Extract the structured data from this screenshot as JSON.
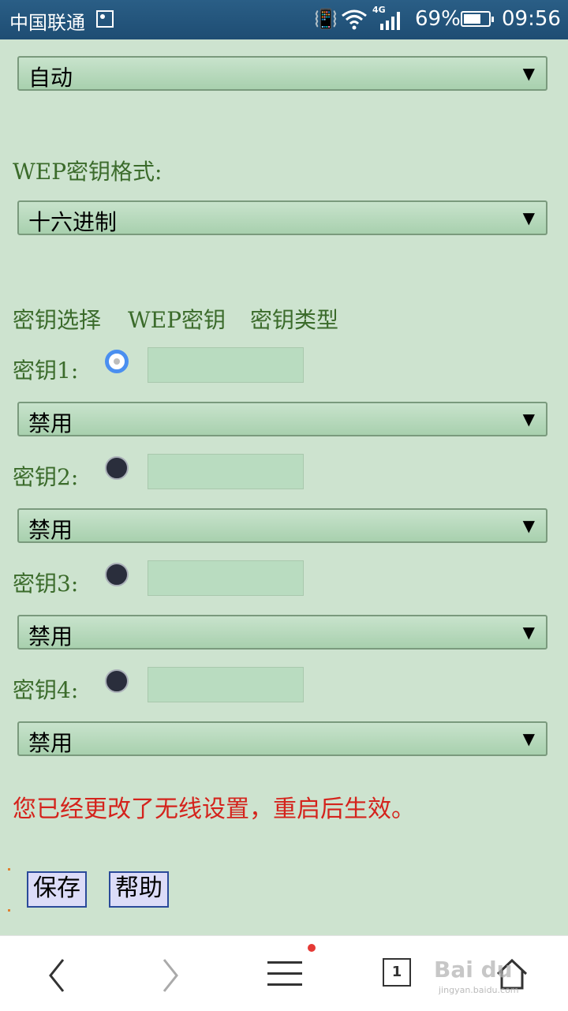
{
  "status_bar": {
    "carrier": "中国联通",
    "network": "4G",
    "battery_pct": "69%",
    "battery_level": 0.69,
    "time": "09:56"
  },
  "form": {
    "auth_select": {
      "value": "自动"
    },
    "wep_format_label": "WEP密钥格式:",
    "wep_format_select": {
      "value": "十六进制"
    },
    "headers": {
      "select": "密钥选择",
      "key": "WEP密钥",
      "type": "密钥类型"
    },
    "keys": [
      {
        "label": "密钥1:",
        "selected": true,
        "value": "",
        "type": "禁用"
      },
      {
        "label": "密钥2:",
        "selected": false,
        "value": "",
        "type": "禁用"
      },
      {
        "label": "密钥3:",
        "selected": false,
        "value": "",
        "type": "禁用"
      },
      {
        "label": "密钥4:",
        "selected": false,
        "value": "",
        "type": "禁用"
      }
    ],
    "warning": "您已经更改了无线设置，重启后生效。",
    "save_label": "保存",
    "help_label": "帮助",
    "arrow": "▼"
  },
  "nav": {
    "tab_count": "1"
  },
  "watermark": {
    "brand": "Bai du",
    "site": "jingyan.baidu.com"
  },
  "colors": {
    "label_green": "#3b6b2b",
    "warning_red": "#d4231c",
    "bg": "#cde3cf"
  }
}
